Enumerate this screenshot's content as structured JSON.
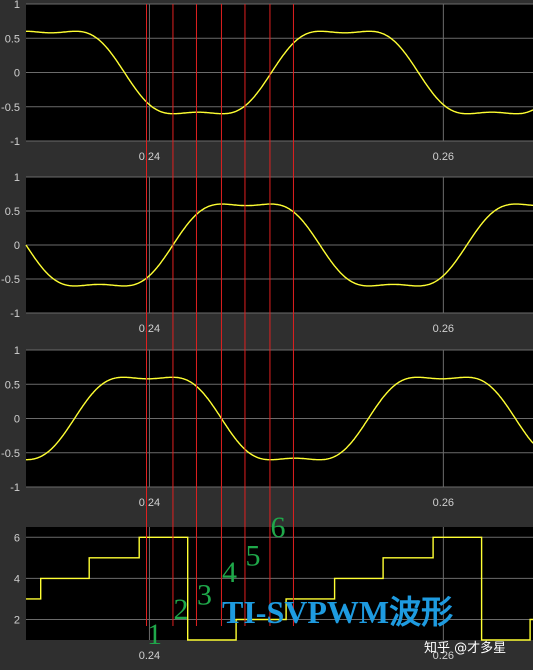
{
  "chart_data": [
    {
      "type": "line",
      "panel": 1,
      "x_ticks": [
        "0.24",
        "0.26"
      ],
      "y_ticks": [
        "1",
        "0.5",
        "0",
        "-0.5",
        "-1"
      ],
      "xlim": [
        0.2316,
        0.2661
      ],
      "ylim": [
        -1,
        1
      ],
      "waveform": "space-vector saddle wave",
      "amplitude": 0.79,
      "period": 0.02,
      "phase_zero_x": 0.2283,
      "grid": true
    },
    {
      "type": "line",
      "panel": 2,
      "x_ticks": [
        "0.24",
        "0.26"
      ],
      "y_ticks": [
        "1",
        "0.5",
        "0",
        "-0.5",
        "-1"
      ],
      "xlim": [
        0.2316,
        0.2661
      ],
      "ylim": [
        -1,
        1
      ],
      "waveform": "space-vector saddle wave",
      "amplitude": 0.79,
      "period": 0.02,
      "phase_zero_x": 0.2216,
      "grid": true
    },
    {
      "type": "line",
      "panel": 3,
      "x_ticks": [
        "0.24",
        "0.26"
      ],
      "y_ticks": [
        "1",
        "0.5",
        "0",
        "-0.5",
        "-1"
      ],
      "xlim": [
        0.2316,
        0.2661
      ],
      "ylim": [
        -1,
        1
      ],
      "waveform": "space-vector saddle wave",
      "amplitude": 0.79,
      "period": 0.02,
      "phase_zero_x": 0.2349,
      "grid": true
    },
    {
      "type": "line",
      "panel": 4,
      "subtype": "step",
      "x_ticks": [
        "0.24",
        "0.26"
      ],
      "y_ticks": [
        "6",
        "4",
        "2"
      ],
      "xlim": [
        0.2316,
        0.2661
      ],
      "ylim": [
        1,
        6.5
      ],
      "x": [
        0.2316,
        0.2326,
        0.2326,
        0.2359,
        0.2359,
        0.2393,
        0.2393,
        0.2426,
        0.2426,
        0.2459,
        0.2459,
        0.2493,
        0.2493,
        0.2526,
        0.2526,
        0.2559,
        0.2559,
        0.2593,
        0.2593,
        0.2626,
        0.2626,
        0.2659,
        0.2659,
        0.2661
      ],
      "y": [
        3,
        3,
        4,
        4,
        5,
        5,
        6,
        6,
        1,
        1,
        2,
        2,
        3,
        3,
        4,
        4,
        5,
        5,
        6,
        6,
        1,
        1,
        2,
        2
      ]
    }
  ],
  "sector_markers_x": [
    0.2398,
    0.2416,
    0.2432,
    0.2449,
    0.2465,
    0.2482,
    0.2498
  ],
  "sector_labels": [
    {
      "text": "1",
      "x": 0.2398,
      "y": 1.4
    },
    {
      "text": "2",
      "x": 0.2416,
      "y": 2.6
    },
    {
      "text": "3",
      "x": 0.2432,
      "y": 3.3
    },
    {
      "text": "4",
      "x": 0.2449,
      "y": 4.4
    },
    {
      "text": "5",
      "x": 0.2465,
      "y": 5.2
    },
    {
      "text": "6",
      "x": 0.2482,
      "y": 6.6
    }
  ],
  "overlay_title": "TI-SVPWM波形",
  "watermark": "知乎 @才多星",
  "colors": {
    "panel_bg": "#000000",
    "figure_bg": "#2f2f2f",
    "trace": "#ffff33",
    "marker": "#e02020",
    "numbers": "#1fa84a",
    "title": "#1e9be0"
  }
}
